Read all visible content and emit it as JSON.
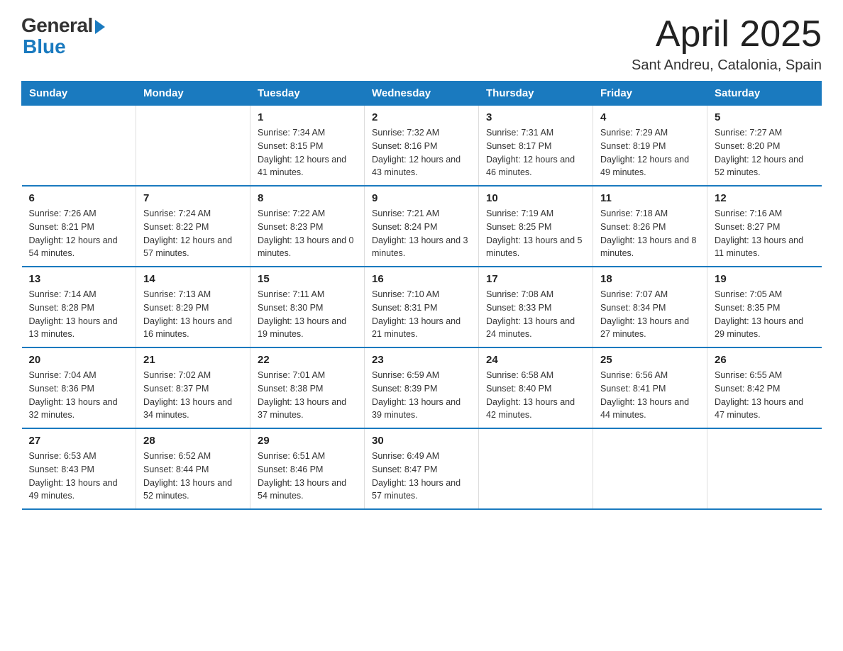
{
  "logo": {
    "general": "General",
    "blue": "Blue"
  },
  "title": "April 2025",
  "subtitle": "Sant Andreu, Catalonia, Spain",
  "weekdays": [
    "Sunday",
    "Monday",
    "Tuesday",
    "Wednesday",
    "Thursday",
    "Friday",
    "Saturday"
  ],
  "weeks": [
    [
      {
        "day": "",
        "info": ""
      },
      {
        "day": "",
        "info": ""
      },
      {
        "day": "1",
        "info": "Sunrise: 7:34 AM\nSunset: 8:15 PM\nDaylight: 12 hours\nand 41 minutes."
      },
      {
        "day": "2",
        "info": "Sunrise: 7:32 AM\nSunset: 8:16 PM\nDaylight: 12 hours\nand 43 minutes."
      },
      {
        "day": "3",
        "info": "Sunrise: 7:31 AM\nSunset: 8:17 PM\nDaylight: 12 hours\nand 46 minutes."
      },
      {
        "day": "4",
        "info": "Sunrise: 7:29 AM\nSunset: 8:19 PM\nDaylight: 12 hours\nand 49 minutes."
      },
      {
        "day": "5",
        "info": "Sunrise: 7:27 AM\nSunset: 8:20 PM\nDaylight: 12 hours\nand 52 minutes."
      }
    ],
    [
      {
        "day": "6",
        "info": "Sunrise: 7:26 AM\nSunset: 8:21 PM\nDaylight: 12 hours\nand 54 minutes."
      },
      {
        "day": "7",
        "info": "Sunrise: 7:24 AM\nSunset: 8:22 PM\nDaylight: 12 hours\nand 57 minutes."
      },
      {
        "day": "8",
        "info": "Sunrise: 7:22 AM\nSunset: 8:23 PM\nDaylight: 13 hours\nand 0 minutes."
      },
      {
        "day": "9",
        "info": "Sunrise: 7:21 AM\nSunset: 8:24 PM\nDaylight: 13 hours\nand 3 minutes."
      },
      {
        "day": "10",
        "info": "Sunrise: 7:19 AM\nSunset: 8:25 PM\nDaylight: 13 hours\nand 5 minutes."
      },
      {
        "day": "11",
        "info": "Sunrise: 7:18 AM\nSunset: 8:26 PM\nDaylight: 13 hours\nand 8 minutes."
      },
      {
        "day": "12",
        "info": "Sunrise: 7:16 AM\nSunset: 8:27 PM\nDaylight: 13 hours\nand 11 minutes."
      }
    ],
    [
      {
        "day": "13",
        "info": "Sunrise: 7:14 AM\nSunset: 8:28 PM\nDaylight: 13 hours\nand 13 minutes."
      },
      {
        "day": "14",
        "info": "Sunrise: 7:13 AM\nSunset: 8:29 PM\nDaylight: 13 hours\nand 16 minutes."
      },
      {
        "day": "15",
        "info": "Sunrise: 7:11 AM\nSunset: 8:30 PM\nDaylight: 13 hours\nand 19 minutes."
      },
      {
        "day": "16",
        "info": "Sunrise: 7:10 AM\nSunset: 8:31 PM\nDaylight: 13 hours\nand 21 minutes."
      },
      {
        "day": "17",
        "info": "Sunrise: 7:08 AM\nSunset: 8:33 PM\nDaylight: 13 hours\nand 24 minutes."
      },
      {
        "day": "18",
        "info": "Sunrise: 7:07 AM\nSunset: 8:34 PM\nDaylight: 13 hours\nand 27 minutes."
      },
      {
        "day": "19",
        "info": "Sunrise: 7:05 AM\nSunset: 8:35 PM\nDaylight: 13 hours\nand 29 minutes."
      }
    ],
    [
      {
        "day": "20",
        "info": "Sunrise: 7:04 AM\nSunset: 8:36 PM\nDaylight: 13 hours\nand 32 minutes."
      },
      {
        "day": "21",
        "info": "Sunrise: 7:02 AM\nSunset: 8:37 PM\nDaylight: 13 hours\nand 34 minutes."
      },
      {
        "day": "22",
        "info": "Sunrise: 7:01 AM\nSunset: 8:38 PM\nDaylight: 13 hours\nand 37 minutes."
      },
      {
        "day": "23",
        "info": "Sunrise: 6:59 AM\nSunset: 8:39 PM\nDaylight: 13 hours\nand 39 minutes."
      },
      {
        "day": "24",
        "info": "Sunrise: 6:58 AM\nSunset: 8:40 PM\nDaylight: 13 hours\nand 42 minutes."
      },
      {
        "day": "25",
        "info": "Sunrise: 6:56 AM\nSunset: 8:41 PM\nDaylight: 13 hours\nand 44 minutes."
      },
      {
        "day": "26",
        "info": "Sunrise: 6:55 AM\nSunset: 8:42 PM\nDaylight: 13 hours\nand 47 minutes."
      }
    ],
    [
      {
        "day": "27",
        "info": "Sunrise: 6:53 AM\nSunset: 8:43 PM\nDaylight: 13 hours\nand 49 minutes."
      },
      {
        "day": "28",
        "info": "Sunrise: 6:52 AM\nSunset: 8:44 PM\nDaylight: 13 hours\nand 52 minutes."
      },
      {
        "day": "29",
        "info": "Sunrise: 6:51 AM\nSunset: 8:46 PM\nDaylight: 13 hours\nand 54 minutes."
      },
      {
        "day": "30",
        "info": "Sunrise: 6:49 AM\nSunset: 8:47 PM\nDaylight: 13 hours\nand 57 minutes."
      },
      {
        "day": "",
        "info": ""
      },
      {
        "day": "",
        "info": ""
      },
      {
        "day": "",
        "info": ""
      }
    ]
  ]
}
